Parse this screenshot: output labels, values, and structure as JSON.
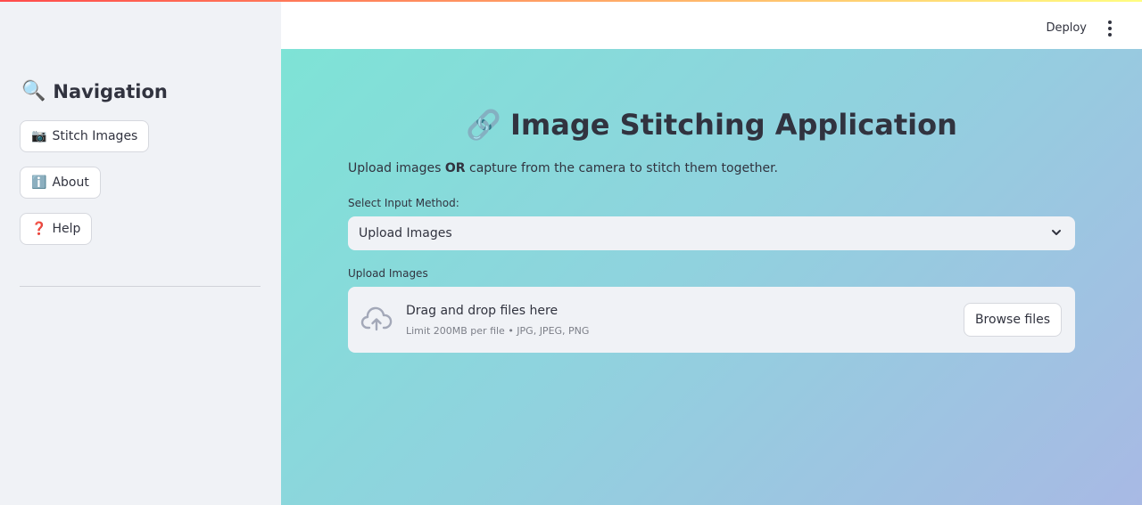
{
  "sidebar": {
    "title_icon": "magnifier-icon",
    "title_glyph": "🔍",
    "title": "Navigation",
    "items": [
      {
        "glyph": "📷",
        "icon": "camera-icon",
        "label": "Stitch Images"
      },
      {
        "glyph": "ℹ️",
        "icon": "info-icon",
        "label": "About"
      },
      {
        "glyph": "❓",
        "icon": "question-icon",
        "label": "Help"
      }
    ]
  },
  "header": {
    "deploy_label": "Deploy",
    "menu_icon": "kebab-menu-icon"
  },
  "main": {
    "title_glyph": "🔗",
    "title_icon": "link-icon",
    "title": "Image Stitching Application",
    "subtitle_pre": "Upload images ",
    "subtitle_bold": "OR",
    "subtitle_post": " capture from the camera to stitch them together.",
    "input_method_label": "Select Input Method:",
    "input_method_value": "Upload Images",
    "upload_label": "Upload Images",
    "dropzone_main": "Drag and drop files here",
    "dropzone_sub": "Limit 200MB per file • JPG, JPEG, PNG",
    "browse_label": "Browse files"
  },
  "colors": {
    "accent_top": "#ff4b4b",
    "sidebar_bg": "#f0f2f6",
    "gradient_start": "#7ee3d6",
    "gradient_end": "#a8b9e4",
    "text": "#31333f"
  }
}
